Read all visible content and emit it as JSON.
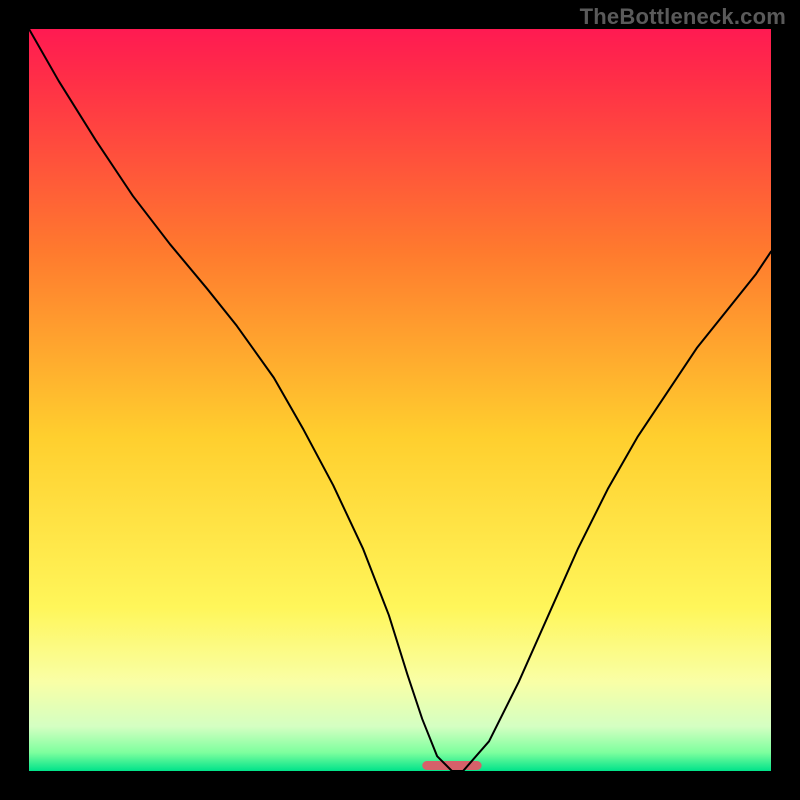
{
  "watermark": "TheBottleneck.com",
  "chart_data": {
    "type": "line",
    "title": "",
    "xlabel": "",
    "ylabel": "",
    "xlim": [
      0,
      100
    ],
    "ylim": [
      0,
      100
    ],
    "grid": false,
    "legend": false,
    "gradient_stops": [
      {
        "offset": 0.0,
        "color": "#ff1a52"
      },
      {
        "offset": 0.07,
        "color": "#ff2f47"
      },
      {
        "offset": 0.3,
        "color": "#ff7a2e"
      },
      {
        "offset": 0.55,
        "color": "#ffcf2e"
      },
      {
        "offset": 0.78,
        "color": "#fff65a"
      },
      {
        "offset": 0.88,
        "color": "#f9ffa6"
      },
      {
        "offset": 0.94,
        "color": "#d4ffc2"
      },
      {
        "offset": 0.975,
        "color": "#7eff9e"
      },
      {
        "offset": 1.0,
        "color": "#00e38a"
      }
    ],
    "series": [
      {
        "name": "bottleneck-curve",
        "x": [
          0,
          4,
          9,
          14,
          19,
          24,
          28,
          33,
          37,
          41,
          45,
          48.5,
          51,
          53,
          55,
          57,
          58.5,
          62,
          66,
          70,
          74,
          78,
          82,
          86,
          90,
          94,
          98,
          100
        ],
        "y": [
          100,
          93,
          85,
          77.5,
          71,
          65,
          60,
          53,
          46,
          38.5,
          30,
          21,
          13,
          7,
          2,
          0,
          0,
          4,
          12,
          21,
          30,
          38,
          45,
          51,
          57,
          62,
          67,
          70
        ]
      }
    ],
    "marker": {
      "name": "optimal-marker",
      "x_center": 57,
      "width": 8,
      "color": "#d6616a",
      "radius": 4.5
    }
  }
}
